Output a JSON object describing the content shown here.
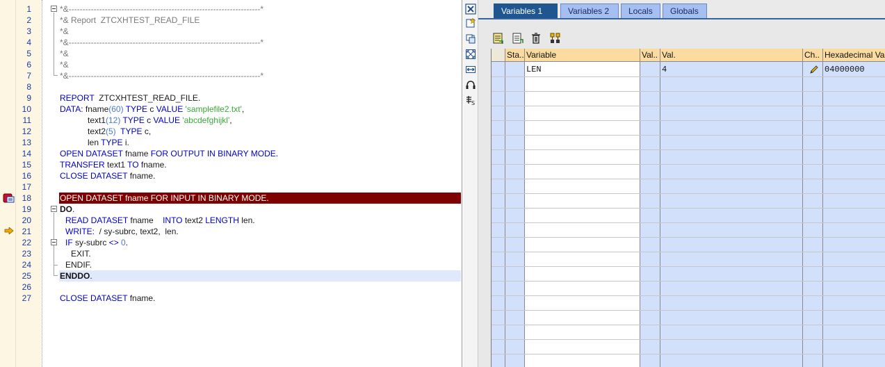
{
  "editor": {
    "lines": [
      {
        "n": "1",
        "text": "*&---------------------------------------------------------------------*"
      },
      {
        "n": "2",
        "text": "*& Report  ZTCXHTEST_READ_FILE"
      },
      {
        "n": "3",
        "text": "*&"
      },
      {
        "n": "4",
        "text": "*&---------------------------------------------------------------------*"
      },
      {
        "n": "5",
        "text": "*&"
      },
      {
        "n": "6",
        "text": "*&"
      },
      {
        "n": "7",
        "text": "*&---------------------------------------------------------------------*"
      },
      {
        "n": "8",
        "text": ""
      },
      {
        "n": "9",
        "text": "REPORT  ZTCXHTEST_READ_FILE."
      },
      {
        "n": "10",
        "text": "DATA: fname(60) TYPE c VALUE 'samplefile2.txt',"
      },
      {
        "n": "11",
        "text": "          text1(12) TYPE c VALUE 'abcdefghijkl',"
      },
      {
        "n": "12",
        "text": "          text2(5)  TYPE c,"
      },
      {
        "n": "13",
        "text": "          len TYPE i."
      },
      {
        "n": "14",
        "text": "OPEN DATASET fname FOR OUTPUT IN BINARY MODE."
      },
      {
        "n": "15",
        "text": "TRANSFER text1 TO fname."
      },
      {
        "n": "16",
        "text": "CLOSE DATASET fname."
      },
      {
        "n": "17",
        "text": ""
      },
      {
        "n": "18",
        "text": "OPEN DATASET fname FOR INPUT IN BINARY MODE."
      },
      {
        "n": "19",
        "text": "DO."
      },
      {
        "n": "20",
        "text": "  READ DATASET fname   INTO text2 LENGTH len."
      },
      {
        "n": "21",
        "text": "  WRITE:  / sy-subrc, text2,  len."
      },
      {
        "n": "22",
        "text": "  IF sy-subrc <> 0."
      },
      {
        "n": "23",
        "text": "    EXIT."
      },
      {
        "n": "24",
        "text": "  ENDIF."
      },
      {
        "n": "25",
        "text": "ENDDO."
      },
      {
        "n": "26",
        "text": ""
      },
      {
        "n": "27",
        "text": "CLOSE DATASET fname."
      }
    ],
    "tokens": {
      "l9a": "REPORT",
      "l9b": "  ZTCXHTEST_READ_FILE.",
      "l10a": "DATA:",
      "l10b": " fname",
      "l10c": "(60)",
      "l10d": " TYPE",
      "l10e": " c ",
      "l10f": "VALUE",
      "l10g": " 'samplefile2.txt'",
      ",": ",",
      "l11a": "text1",
      "l11b": "(12)",
      "l11c": " TYPE",
      "l11d": " c ",
      "l11e": "VALUE",
      "l11f": " 'abcdefghijkl'",
      "l11g": ",",
      "l12a": "text2",
      "l12b": "(5)",
      "l12c": "  TYPE",
      "l12d": " c,",
      "l13a": "len ",
      "l13b": "TYPE",
      "l13c": " i.",
      "l14a": "OPEN DATASET",
      "l14b": " fname ",
      "l14c": "FOR OUTPUT IN BINARY MODE.",
      "l15a": "TRANSFER",
      "l15b": " text1 ",
      "l15c": "TO",
      "l15d": " fname.",
      "l16a": "CLOSE DATASET",
      "l16b": " fname.",
      "l18": "OPEN DATASET fname FOR INPUT IN BINARY MODE.",
      "l19": "DO",
      "l20a": "READ DATASET",
      "l20b": " fname    ",
      "l20c": "INTO",
      "l20d": " text2 ",
      "l20e": "LENGTH",
      "l20f": " len.",
      "l21a": "WRITE:",
      "l21b": "  / sy-subrc, text2,  len.",
      "l22a": "IF",
      "l22b": " sy-subrc ",
      "l22c": "<>",
      "l22d": " 0",
      "l23": "EXIT.",
      "l24": "ENDIF.",
      "l25": "ENDDO",
      "l27a": "CLOSE DATASET",
      "l27b": " fname.",
      "dot": "."
    }
  },
  "icons": {
    "breakpoint": "breakpoint-icon",
    "current_line": "current-line-arrow-icon"
  },
  "debugger": {
    "tabs": [
      "Variables 1",
      "Variables 2",
      "Locals",
      "Globals"
    ],
    "active_tab": 0,
    "columns": [
      "Sta..",
      "Variable",
      "Val..",
      "Val.",
      "Ch..",
      "Hexadecimal Value"
    ],
    "rows": [
      {
        "variable": "LEN",
        "value": "4",
        "hex": "04000000"
      }
    ]
  },
  "colors": {
    "active_tab": "#1f568f",
    "header": "#fbdba0",
    "grid_blue": "#d3e0fb",
    "exec_line": "#7f0000",
    "current_line": "#dfe9fb"
  }
}
